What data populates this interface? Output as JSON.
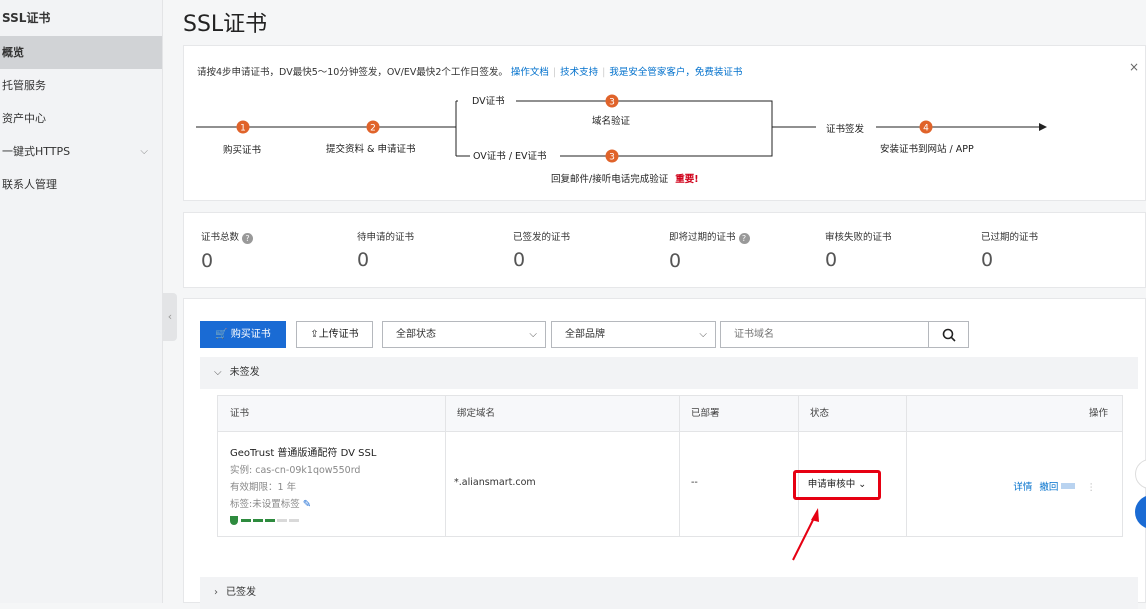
{
  "sidebar": {
    "title": "SSL证书",
    "items": [
      {
        "label": "概览"
      },
      {
        "label": "托管服务"
      },
      {
        "label": "资产中心"
      },
      {
        "label": "一键式HTTPS"
      },
      {
        "label": "联系人管理"
      }
    ]
  },
  "page_title": "SSL证书",
  "guide": {
    "notice": "请按4步申请证书，DV最快5～10分钟签发，OV/EV最快2个工作日签发。",
    "links": [
      "操作文档",
      "技术支持",
      "我是安全管家客户，免费装证书"
    ],
    "close": "×",
    "steps": {
      "s1": {
        "num": "1",
        "label": "购买证书"
      },
      "s2": {
        "num": "2",
        "label": "提交资料 & 申请证书"
      },
      "dv": {
        "num": "3",
        "branch": "DV证书",
        "label": "域名验证"
      },
      "ov": {
        "num": "3",
        "branch": "OV证书 / EV证书",
        "label": "回复邮件/接听电话完成验证",
        "important": "重要!"
      },
      "s4": {
        "num": "4",
        "branch": "证书签发",
        "label": "安装证书到网站 / APP"
      }
    },
    "accent": "#e0632a"
  },
  "stats": [
    {
      "label": "证书总数",
      "value": "0",
      "help": "?"
    },
    {
      "label": "待申请的证书",
      "value": "0"
    },
    {
      "label": "已签发的证书",
      "value": "0"
    },
    {
      "label": "即将过期的证书",
      "value": "0",
      "help": "?"
    },
    {
      "label": "审核失败的证书",
      "value": "0"
    },
    {
      "label": "已过期的证书",
      "value": "0"
    }
  ],
  "toolbar": {
    "buy_label": "购买证书",
    "upload_label": "上传证书",
    "status_select": "全部状态",
    "brand_select": "全部品牌",
    "search_placeholder": "证书域名"
  },
  "groups": {
    "unsigned": "未签发",
    "signed": "已签发"
  },
  "table": {
    "columns": [
      "证书",
      "绑定域名",
      "已部署",
      "状态",
      "操作"
    ],
    "row": {
      "cert_name": "GeoTrust 普通版通配符 DV SSL",
      "instance": "实例: cas-cn-09k1qow550rd",
      "validity": "有效期限：1 年",
      "tag": "标签:未设置标签",
      "domain": "*.aliansmart.com",
      "deployed": "--",
      "status": "申请审核中",
      "op_detail": "详情",
      "op_revoke": "撤回",
      "op_more": "⋮",
      "progress_filled": 3,
      "progress_total": 5
    }
  },
  "colors": {
    "primary": "#1a6bd4",
    "link": "#0070cc",
    "highlight": "#e60012",
    "success": "#2e8b3e"
  }
}
